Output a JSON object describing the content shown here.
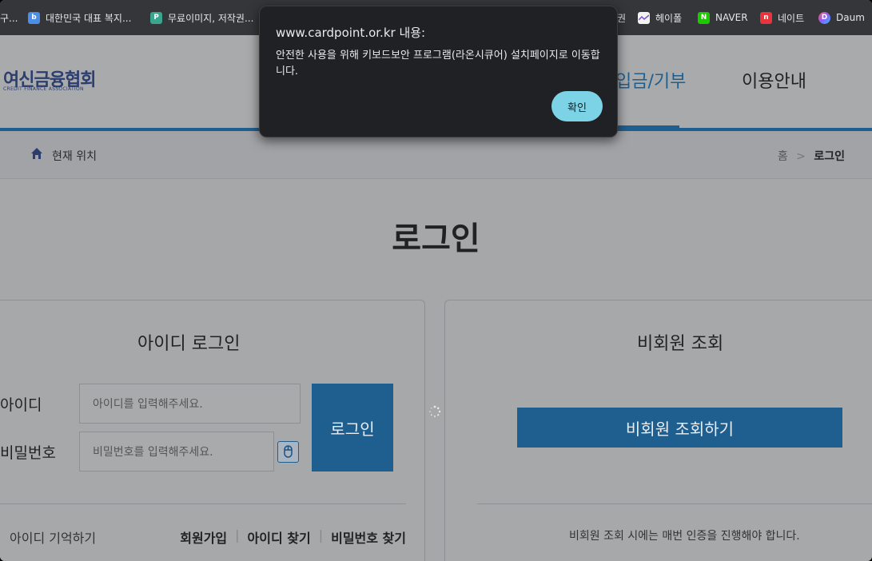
{
  "bookmarks": [
    {
      "label": "구...",
      "icon": "doc-icon"
    },
    {
      "label": "대한민국 대표 복지...",
      "icon": "welfare-icon"
    },
    {
      "label": "무료이미지, 저작권...",
      "icon": "image-icon"
    },
    {
      "label": "권",
      "icon": ""
    },
    {
      "label": "헤이폴",
      "icon": "heypoll-icon"
    },
    {
      "label": "NAVER",
      "icon": "naver-icon"
    },
    {
      "label": "네이트",
      "icon": "nate-icon"
    },
    {
      "label": "Daum",
      "icon": "daum-icon"
    }
  ],
  "header": {
    "logo_kr": "여신금융협회",
    "logo_en": "CREDIT FINANCE ASSOCIATION",
    "nav": [
      "입금/기부",
      "이용안내"
    ]
  },
  "breadcrumb": {
    "location_label": "현재 위치",
    "home": "홈",
    "separator": ">",
    "current": "로그인"
  },
  "page": {
    "title": "로그인"
  },
  "id_login": {
    "title": "아이디 로그인",
    "id_label": "아이디",
    "id_placeholder": "아이디를 입력해주세요.",
    "pw_label": "비밀번호",
    "pw_placeholder": "비밀번호를 입력해주세요.",
    "login_button": "로그인",
    "remember": "아이디 기억하기",
    "links": [
      "회원가입",
      "아이디 찾기",
      "비밀번호 찾기"
    ]
  },
  "guest": {
    "title": "비회원 조회",
    "button": "비회원 조회하기",
    "note": "비회원 조회 시에는 매번 인증을 진행해야 합니다."
  },
  "dialog": {
    "title": "www.cardpoint.or.kr 내용:",
    "message": "안전한 사용을 위해 키보드보안 프로그램(라온시큐어) 설치페이지로 이동합니다.",
    "ok": "확인"
  },
  "colors": {
    "accent": "#1f5f8f",
    "dialog_bg": "#202124",
    "dialog_button": "#7cd3e6"
  }
}
